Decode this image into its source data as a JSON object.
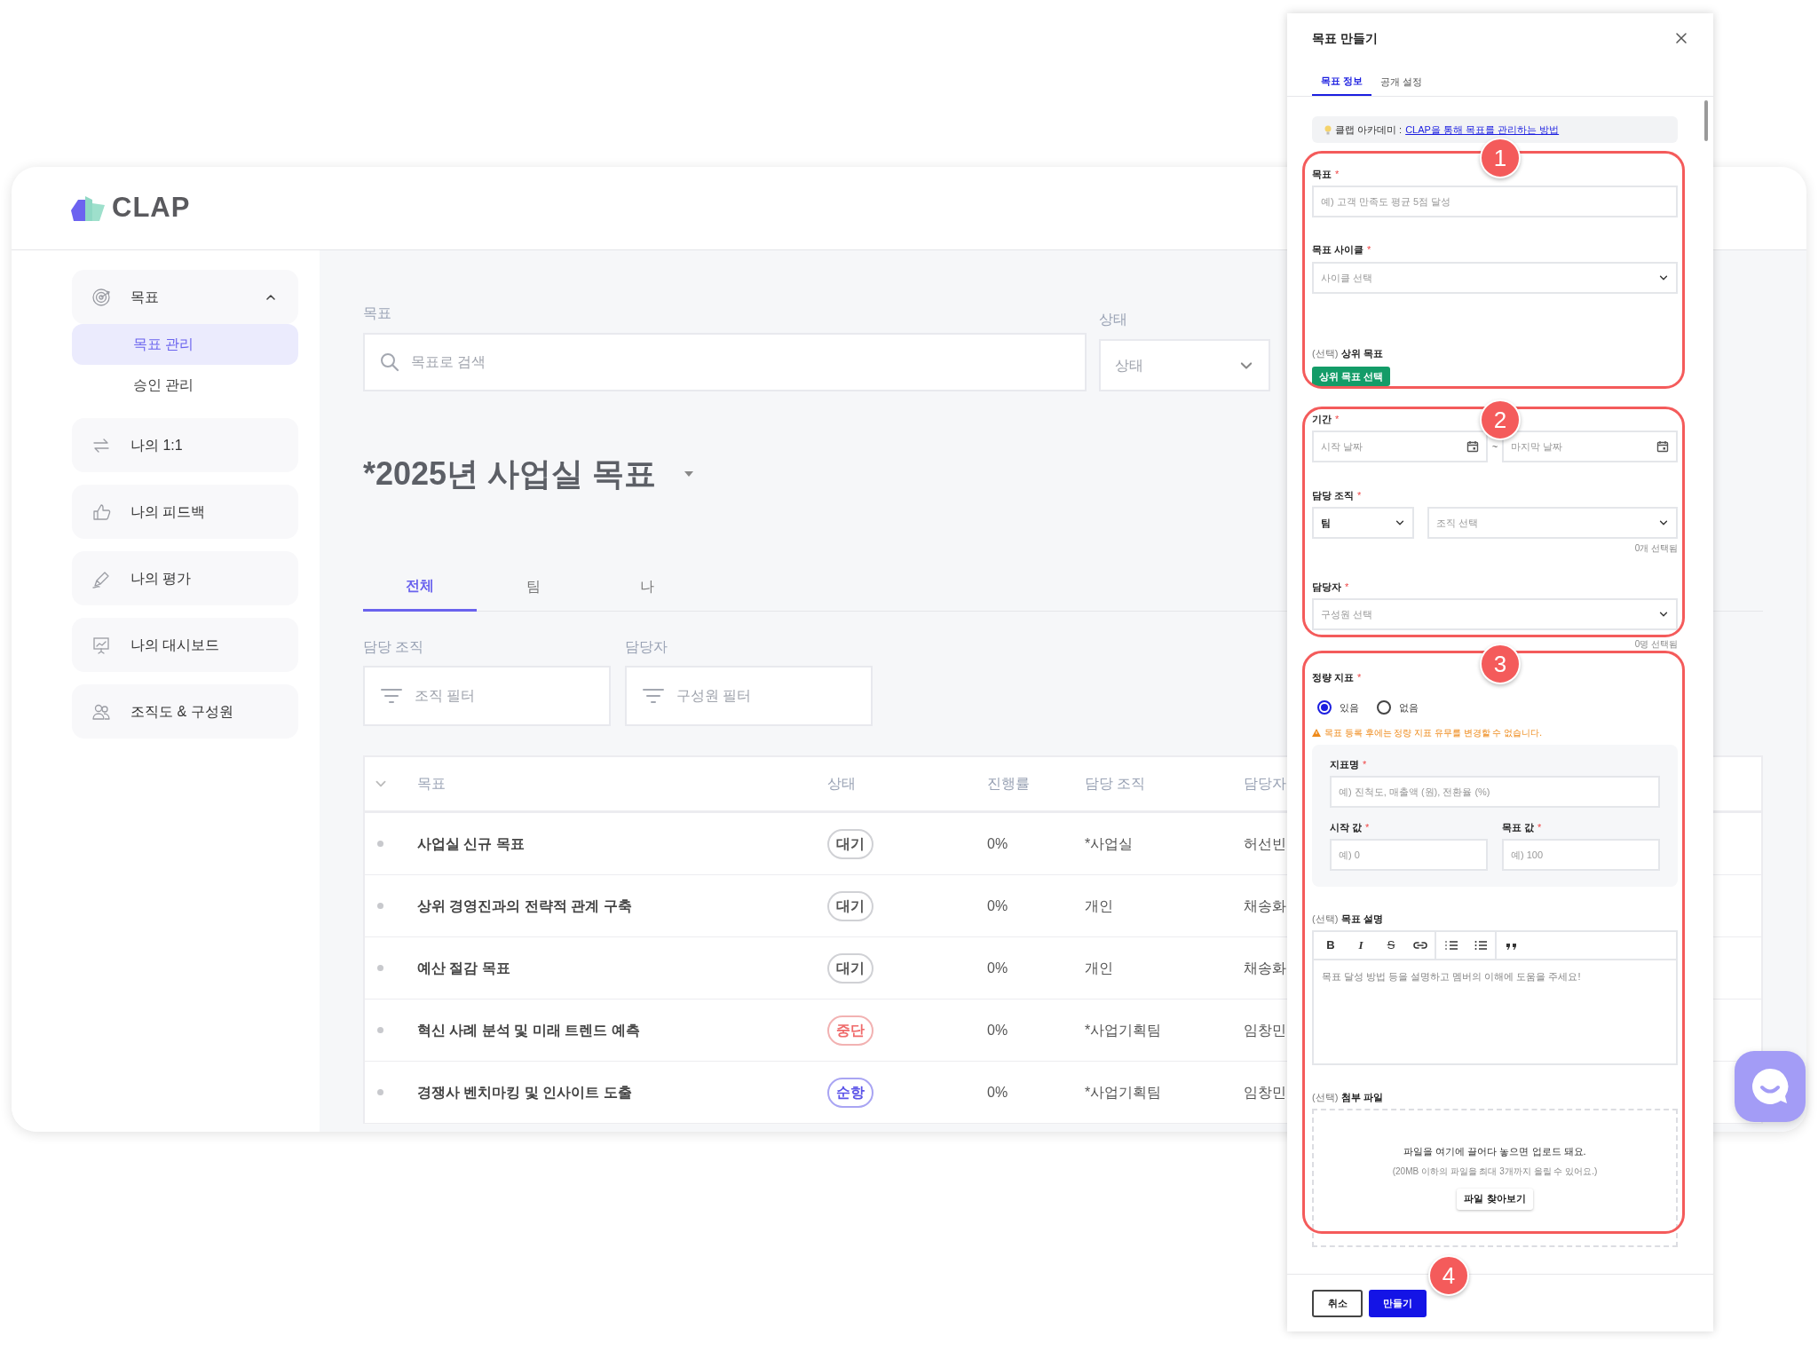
{
  "app": {
    "logo": "CLAP"
  },
  "sidebar": {
    "items": [
      {
        "label": "목표",
        "expanded": true,
        "children": [
          {
            "label": "목표 관리",
            "selected": true
          },
          {
            "label": "승인 관리",
            "selected": false
          }
        ]
      },
      {
        "label": "나의 1:1"
      },
      {
        "label": "나의 피드백"
      },
      {
        "label": "나의 평가"
      },
      {
        "label": "나의 대시보드"
      },
      {
        "label": "조직도 & 구성원"
      }
    ]
  },
  "search": {
    "label": "목표",
    "placeholder": "목표로 검색",
    "status_label": "상태",
    "status_placeholder": "상태"
  },
  "title": "*2025년 사업실 목표",
  "tabs": [
    {
      "label": "전체",
      "selected": true
    },
    {
      "label": "팀",
      "selected": false
    },
    {
      "label": "나",
      "selected": false
    }
  ],
  "filters": [
    {
      "label": "담당 조직",
      "placeholder": "조직 필터"
    },
    {
      "label": "담당자",
      "placeholder": "구성원 필터"
    }
  ],
  "table": {
    "columns": [
      "목표",
      "상태",
      "진행률",
      "담당 조직",
      "담당자"
    ],
    "rows": [
      {
        "goal": "사업실 신규 목표",
        "status": "대기",
        "kind": "waiting",
        "progress": "0%",
        "org": "*사업실",
        "owner": "허선빈"
      },
      {
        "goal": "상위 경영진과의 전략적 관계 구축",
        "status": "대기",
        "kind": "waiting",
        "progress": "0%",
        "org": "개인",
        "owner": "채송화"
      },
      {
        "goal": "예산 절감 목표",
        "status": "대기",
        "kind": "waiting",
        "progress": "0%",
        "org": "개인",
        "owner": "채송화"
      },
      {
        "goal": "혁신 사례 분석 및 미래 트렌드 예측",
        "status": "중단",
        "kind": "stopped",
        "progress": "0%",
        "org": "*사업기획팀",
        "owner": "임창민"
      },
      {
        "goal": "경쟁사 벤치마킹 및 인사이트 도출",
        "status": "순항",
        "kind": "on_track",
        "progress": "0%",
        "org": "*사업기획팀",
        "owner": "임창민"
      }
    ]
  },
  "panel": {
    "title": "목표 만들기",
    "tabs": [
      {
        "label": "목표 정보",
        "selected": true
      },
      {
        "label": "공개 설정",
        "selected": false
      }
    ],
    "tip": {
      "prefix": "클랩 아카데미 :",
      "link": "CLAP을 통해 목표를 관리하는 방법"
    },
    "goal": {
      "label": "목표",
      "mark": "*",
      "placeholder": "예) 고객 만족도 평균 5점 달성"
    },
    "cycle": {
      "label": "목표 사이클",
      "mark": "*",
      "placeholder": "사이클 선택"
    },
    "parent": {
      "prefix": "(선택)",
      "label": "상위 목표",
      "button": "상위 목표 선택"
    },
    "period": {
      "label": "기간",
      "mark": "*",
      "start_placeholder": "시작 날짜",
      "separator": "~",
      "end_placeholder": "마지막 날짜"
    },
    "org": {
      "label": "담당 조직",
      "mark": "*",
      "type_value": "팀",
      "placeholder": "조직 선택",
      "count": "0개 선택됨"
    },
    "owner": {
      "label": "담당자",
      "mark": "*",
      "placeholder": "구성원 선택",
      "count": "0명 선택됨"
    },
    "metric": {
      "label": "정량 지표",
      "mark": "*",
      "options": [
        {
          "label": "있음",
          "selected": true
        },
        {
          "label": "없음",
          "selected": false
        }
      ],
      "warning": "목표 등록 후에는 정량 지표 유무를 변경할 수 없습니다.",
      "name": {
        "label": "지표명",
        "mark": "*",
        "placeholder": "예) 진척도, 매출액 (원), 전환율 (%)"
      },
      "start": {
        "label": "시작 값",
        "mark": "*",
        "placeholder": "예) 0"
      },
      "target": {
        "label": "목표 값",
        "mark": "*",
        "placeholder": "예) 100"
      }
    },
    "description": {
      "prefix": "(선택)",
      "label": "목표 설명",
      "placeholder": "목표 달성 방법 등을 설명하고 멤버의 이해에 도움을 주세요!",
      "toolbar": [
        {
          "kind": "bold",
          "text": "B"
        },
        {
          "kind": "italic",
          "text": "I"
        },
        {
          "kind": "strike",
          "text": "S"
        },
        {
          "kind": "link"
        },
        {
          "kind": "ordered"
        },
        {
          "kind": "bullet"
        },
        {
          "kind": "quote"
        }
      ]
    },
    "attachment": {
      "prefix": "(선택)",
      "label": "첨부 파일",
      "hint": "파일을 여기에 끌어다 놓으면 업로드 돼요.",
      "note": "(20MB 이하의 파일을 최대 3개까지 올릴 수 있어요.)",
      "button": "파일 찾아보기"
    },
    "footer": {
      "cancel": "취소",
      "submit": "만들기"
    }
  },
  "annotations": [
    "1",
    "2",
    "3",
    "4"
  ]
}
